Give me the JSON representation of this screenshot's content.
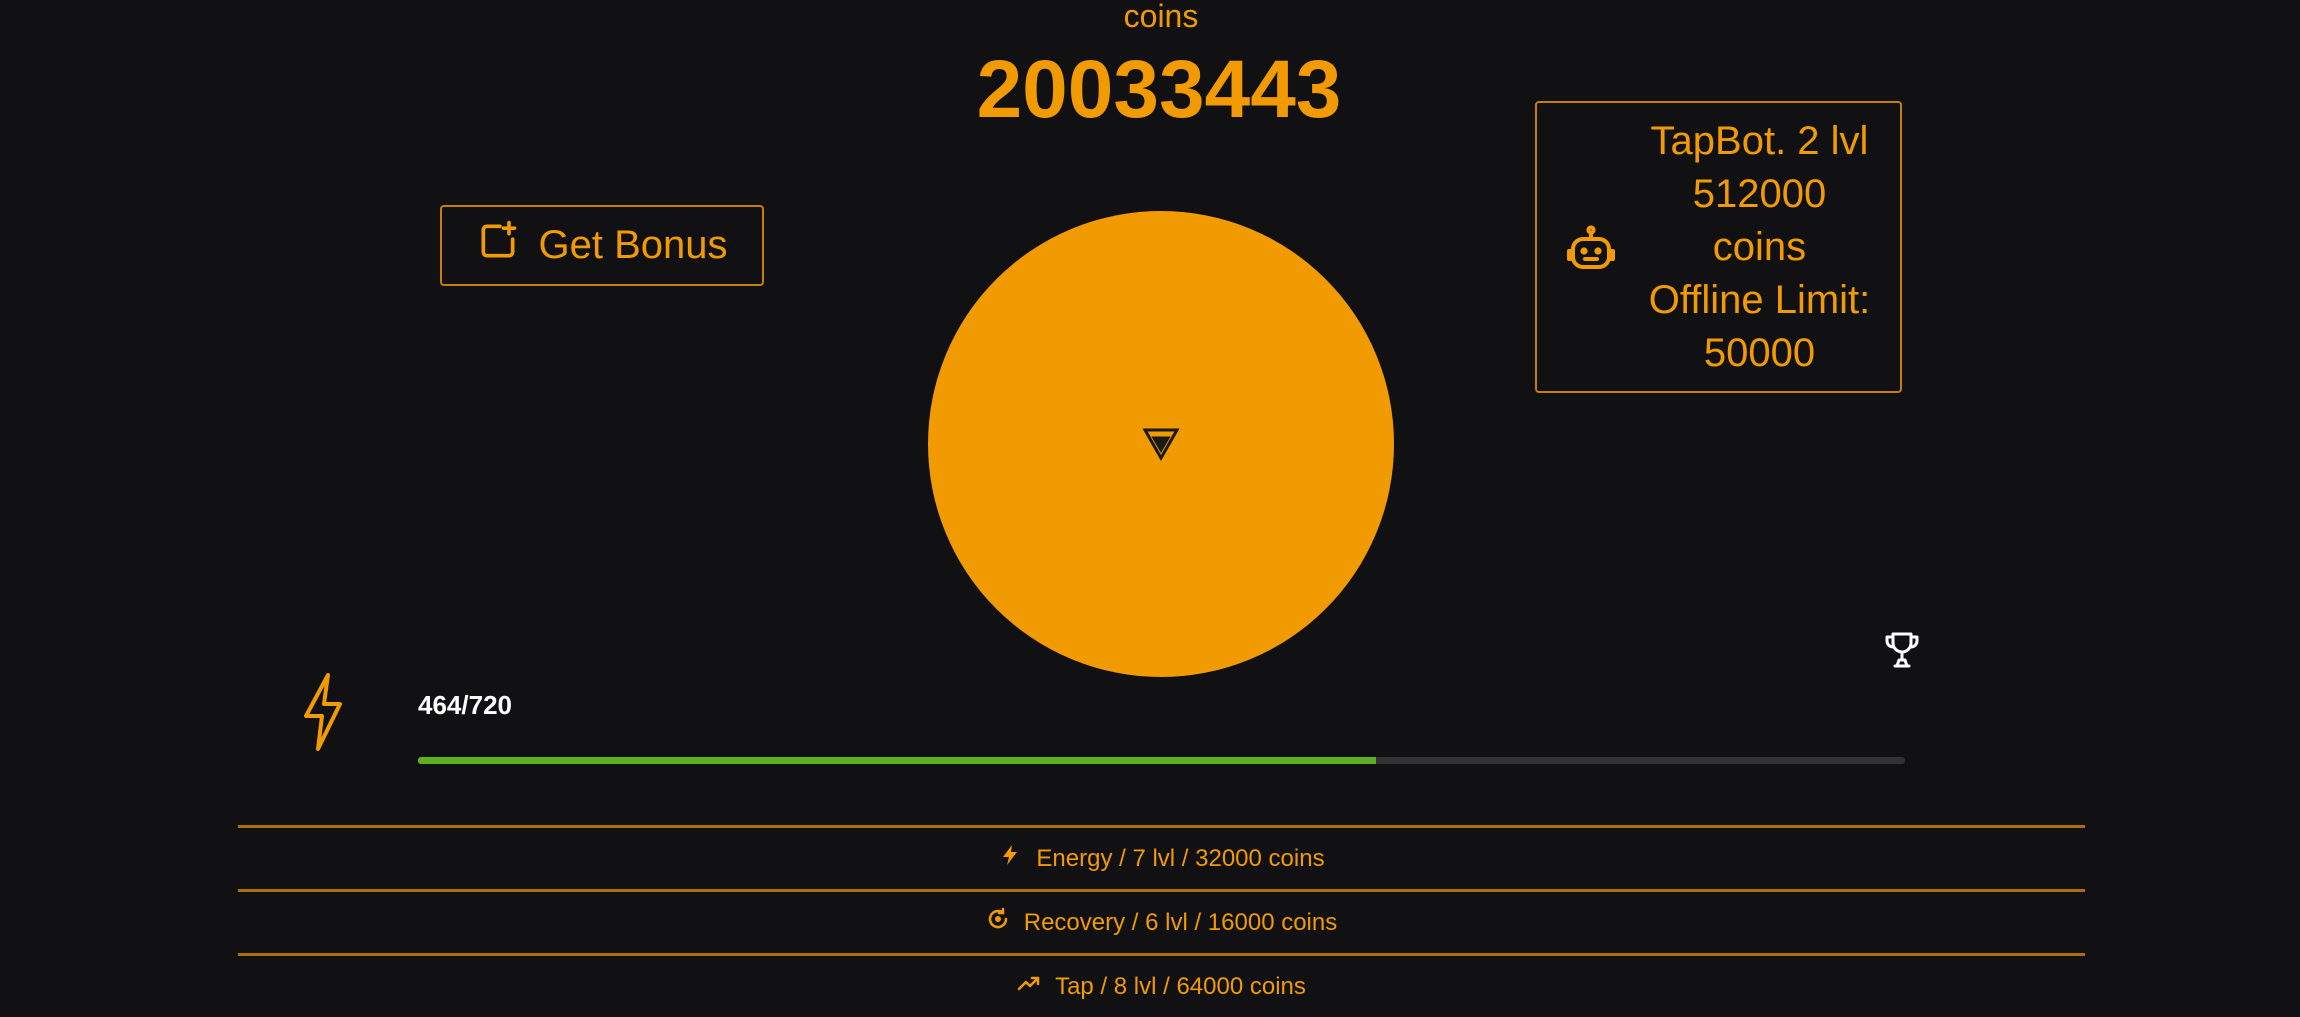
{
  "header": {
    "coins_label": "coins",
    "coins_value": "20033443"
  },
  "bonus": {
    "label": "Get Bonus",
    "icon": "add-square-icon"
  },
  "tapbot": {
    "icon": "robot-icon",
    "lines": [
      "TapBot. 2 lvl",
      "512000",
      "coins",
      "Offline Limit:",
      "50000"
    ]
  },
  "tap_button": {
    "icon": "triangle-logo-icon",
    "color": "#f29a02"
  },
  "leaderboard": {
    "icon": "trophy-icon"
  },
  "energy": {
    "icon": "lightning-icon",
    "text": "464/720",
    "current": 464,
    "max": 720,
    "bar_color": "#5fb020"
  },
  "upgrades": [
    {
      "icon": "lightning-icon",
      "label": "Energy / 7 lvl / 32000 coins"
    },
    {
      "icon": "recovery-icon",
      "label": "Recovery / 6 lvl / 16000 coins"
    },
    {
      "icon": "trending-up-icon",
      "label": "Tap / 8 lvl / 64000 coins"
    }
  ],
  "colors": {
    "accent": "#f29a02",
    "background": "#111113",
    "border": "#c57f06"
  }
}
